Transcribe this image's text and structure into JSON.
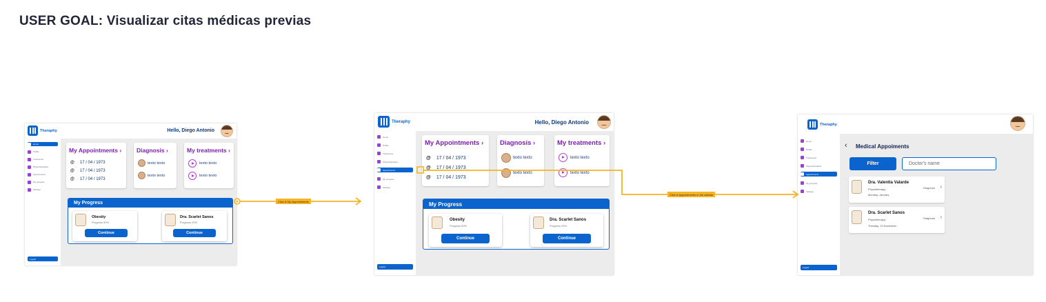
{
  "goal": "USER GOAL: Visualizar citas médicas previas",
  "app": {
    "logo_text": "Theraphy",
    "greeting": "Hello, Diego Antonio",
    "sidebar_items": [
      "Home",
      "Profile",
      "Treatments",
      "Physiotherapists",
      "Appointments",
      "My progress",
      "Settings"
    ],
    "logout": "Logout"
  },
  "dashboard": {
    "appointments_title": "My Appointments",
    "appointment_dates": [
      "17 / 04 / 1973",
      "17 / 04 / 1973",
      "17 / 04 / 1973"
    ],
    "diagnosis_title": "Diagnosis",
    "diagnosis_items": [
      "texto texto",
      "texto texto"
    ],
    "treatments_title": "My treatments",
    "treatment_items": [
      "texto texto",
      "texto texto"
    ],
    "progress_title": "My Progress",
    "progress_cards": [
      {
        "title": "Obesity",
        "sub": "Progress 50%",
        "button": "Continue"
      },
      {
        "title": "Dra. Scarlet Sanos",
        "sub": "Progress 25%",
        "button": "Continue"
      }
    ]
  },
  "transitions": [
    {
      "label": "Click in My Appointments"
    },
    {
      "label": "Click in Appointments in the sidebar"
    }
  ],
  "appointments_page": {
    "title": "Medical Appoiments",
    "filter_label": "Filter",
    "search_placeholder": "Doctor's name",
    "items": [
      {
        "name": "Dra. Valentia Valarde",
        "specialty": "Physiotherapy",
        "date": "Monday, January",
        "right": "Diagnose"
      },
      {
        "name": "Dra. Scarlet Sanos",
        "specialty": "Physiotherapy",
        "date": "Tuesday, 13 November",
        "right": "Diagnose"
      }
    ]
  },
  "colors": {
    "primary": "#0b63ce",
    "accent": "#7d1fb4",
    "flow": "#f5b325"
  }
}
